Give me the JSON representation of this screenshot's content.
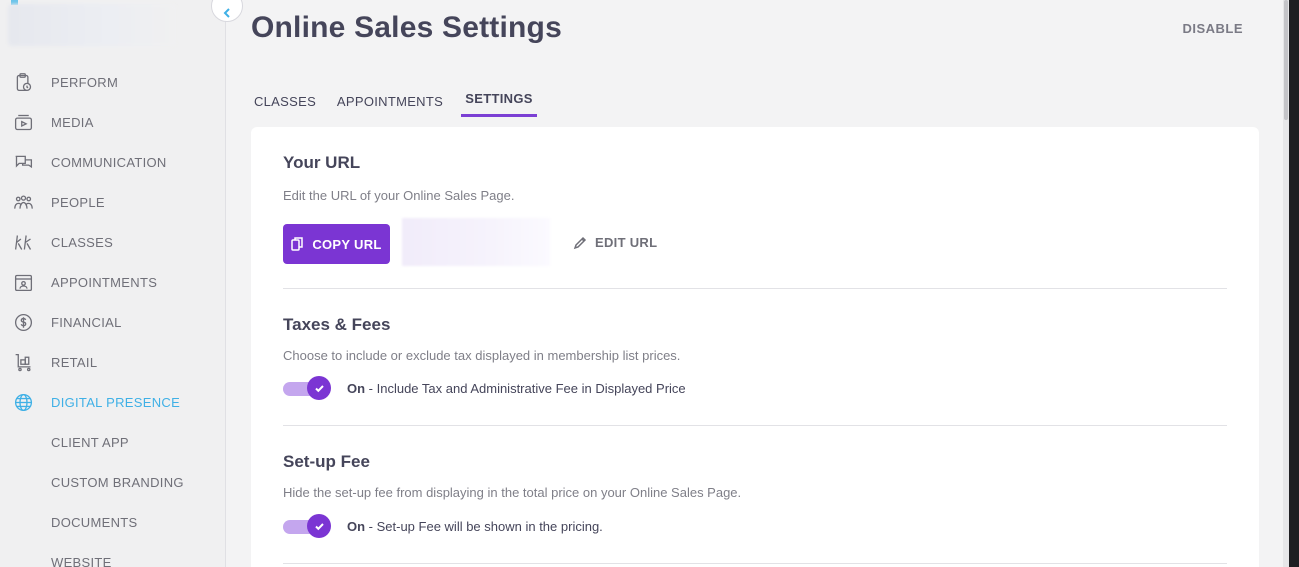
{
  "sidebar": {
    "items": [
      {
        "label": "PERFORM",
        "icon": "clipboard-clock-icon"
      },
      {
        "label": "MEDIA",
        "icon": "media-play-icon"
      },
      {
        "label": "COMMUNICATION",
        "icon": "chat-bubbles-icon"
      },
      {
        "label": "PEOPLE",
        "icon": "people-icon"
      },
      {
        "label": "CLASSES",
        "icon": "classes-figures-icon"
      },
      {
        "label": "APPOINTMENTS",
        "icon": "appointment-icon"
      },
      {
        "label": "FINANCIAL",
        "icon": "dollar-circle-icon"
      },
      {
        "label": "RETAIL",
        "icon": "retail-cart-icon"
      },
      {
        "label": "DIGITAL PRESENCE",
        "icon": "globe-icon",
        "active": true
      }
    ],
    "subitems": [
      {
        "label": "CLIENT APP"
      },
      {
        "label": "CUSTOM BRANDING"
      },
      {
        "label": "DOCUMENTS"
      },
      {
        "label": "WEBSITE"
      }
    ],
    "accent_color": "#3fb0e6"
  },
  "header": {
    "title": "Online Sales Settings",
    "disable_label": "DISABLE"
  },
  "tabs": [
    {
      "label": "CLASSES"
    },
    {
      "label": "APPOINTMENTS"
    },
    {
      "label": "SETTINGS",
      "active": true
    }
  ],
  "url_section": {
    "title": "Your URL",
    "description": "Edit the URL of your Online Sales Page.",
    "copy_label": "COPY URL",
    "edit_label": "EDIT URL"
  },
  "taxes_section": {
    "title": "Taxes & Fees",
    "description": "Choose to include or exclude tax displayed in membership list prices.",
    "toggle_state": "On",
    "toggle_text": " - Include Tax and Administrative Fee in Displayed Price"
  },
  "setup_section": {
    "title": "Set-up Fee",
    "description": "Hide the set-up fee from displaying in the total price on your Online Sales Page.",
    "toggle_state": "On",
    "toggle_text": " - Set-up Fee will be shown in the pricing."
  },
  "colors": {
    "primary": "#7b35d3",
    "toggle_track": "#c4a6ee",
    "active_tab_underline": "#7b3fd4"
  }
}
